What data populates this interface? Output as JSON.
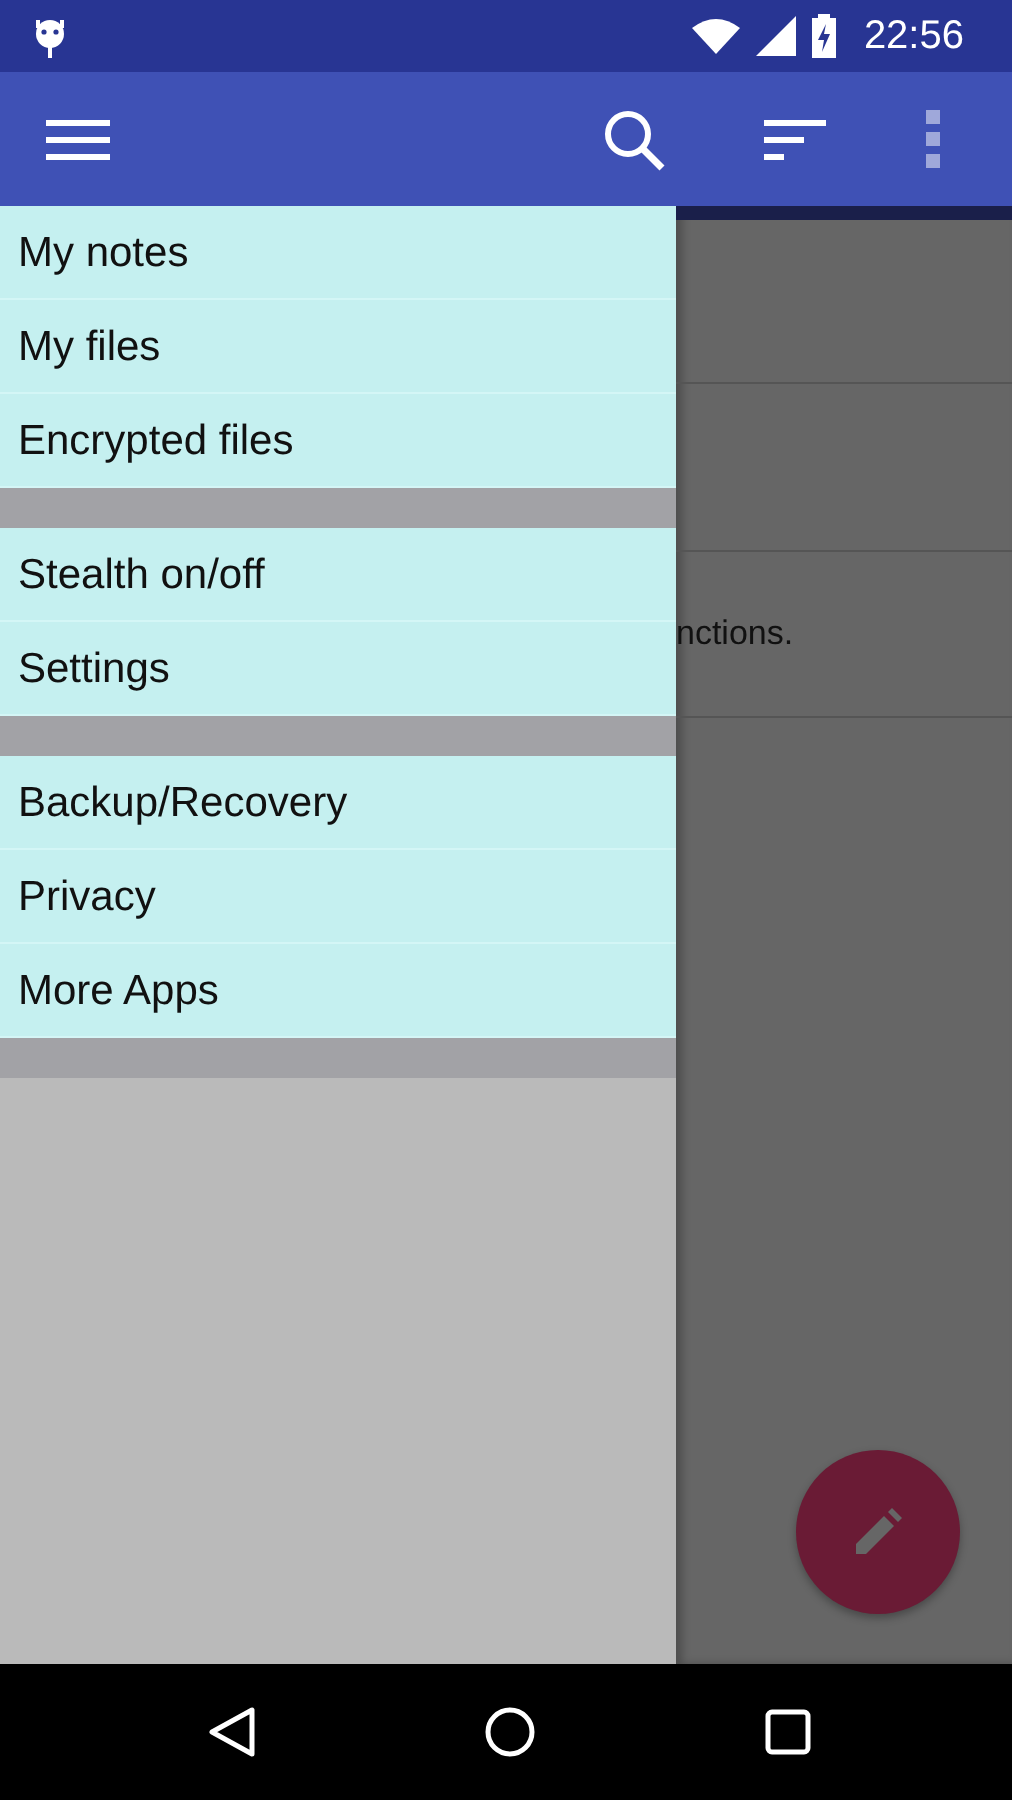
{
  "status_bar": {
    "time": "22:56"
  },
  "drawer": {
    "sections": [
      {
        "items": [
          {
            "label": "My notes"
          },
          {
            "label": "My files"
          },
          {
            "label": "Encrypted files"
          }
        ]
      },
      {
        "items": [
          {
            "label": "Stealth on/off"
          },
          {
            "label": "Settings"
          }
        ]
      },
      {
        "items": [
          {
            "label": "Backup/Recovery"
          },
          {
            "label": "Privacy"
          },
          {
            "label": "More Apps"
          }
        ]
      }
    ]
  },
  "notes": [
    {
      "text": "nctions."
    }
  ]
}
